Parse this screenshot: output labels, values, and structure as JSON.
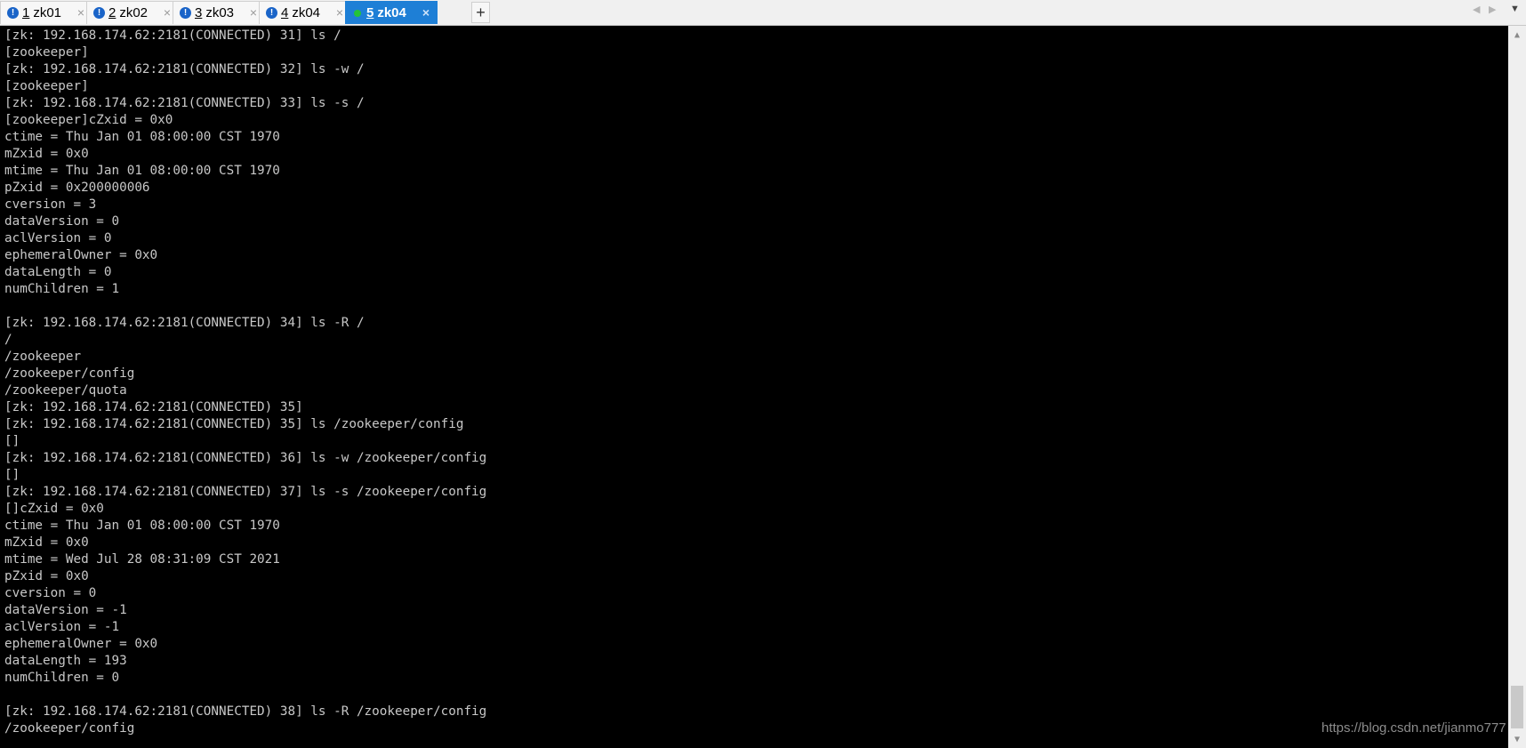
{
  "tabs": [
    {
      "number": "1",
      "name": "zk01",
      "status": "!"
    },
    {
      "number": "2",
      "name": "zk02",
      "status": "!"
    },
    {
      "number": "3",
      "name": "zk03",
      "status": "!"
    },
    {
      "number": "4",
      "name": "zk04",
      "status": "!"
    },
    {
      "number": "5",
      "name": "zk04",
      "status": ""
    }
  ],
  "tab_close_glyph": "×",
  "add_tab_glyph": "+",
  "nav": {
    "prev": "◀",
    "next": "▶",
    "menu": "▼"
  },
  "scroll": {
    "up": "▲",
    "down": "▼"
  },
  "terminal_lines": [
    "[zk: 192.168.174.62:2181(CONNECTED) 31] ls /",
    "[zookeeper]",
    "[zk: 192.168.174.62:2181(CONNECTED) 32] ls -w /",
    "[zookeeper]",
    "[zk: 192.168.174.62:2181(CONNECTED) 33] ls -s /",
    "[zookeeper]cZxid = 0x0",
    "ctime = Thu Jan 01 08:00:00 CST 1970",
    "mZxid = 0x0",
    "mtime = Thu Jan 01 08:00:00 CST 1970",
    "pZxid = 0x200000006",
    "cversion = 3",
    "dataVersion = 0",
    "aclVersion = 0",
    "ephemeralOwner = 0x0",
    "dataLength = 0",
    "numChildren = 1",
    "",
    "[zk: 192.168.174.62:2181(CONNECTED) 34] ls -R /",
    "/",
    "/zookeeper",
    "/zookeeper/config",
    "/zookeeper/quota",
    "[zk: 192.168.174.62:2181(CONNECTED) 35]",
    "[zk: 192.168.174.62:2181(CONNECTED) 35] ls /zookeeper/config",
    "[]",
    "[zk: 192.168.174.62:2181(CONNECTED) 36] ls -w /zookeeper/config",
    "[]",
    "[zk: 192.168.174.62:2181(CONNECTED) 37] ls -s /zookeeper/config",
    "[]cZxid = 0x0",
    "ctime = Thu Jan 01 08:00:00 CST 1970",
    "mZxid = 0x0",
    "mtime = Wed Jul 28 08:31:09 CST 2021",
    "pZxid = 0x0",
    "cversion = 0",
    "dataVersion = -1",
    "aclVersion = -1",
    "ephemeralOwner = 0x0",
    "dataLength = 193",
    "numChildren = 0",
    "",
    "[zk: 192.168.174.62:2181(CONNECTED) 38] ls -R /zookeeper/config",
    "/zookeeper/config"
  ],
  "watermark": "https://blog.csdn.net/jianmo777",
  "colors": {
    "active_tab": "#1e7fd6",
    "status_warning": "#1a64c8",
    "status_ok": "#24c33a",
    "terminal_bg": "#000000",
    "terminal_fg": "#c8c8c8"
  }
}
